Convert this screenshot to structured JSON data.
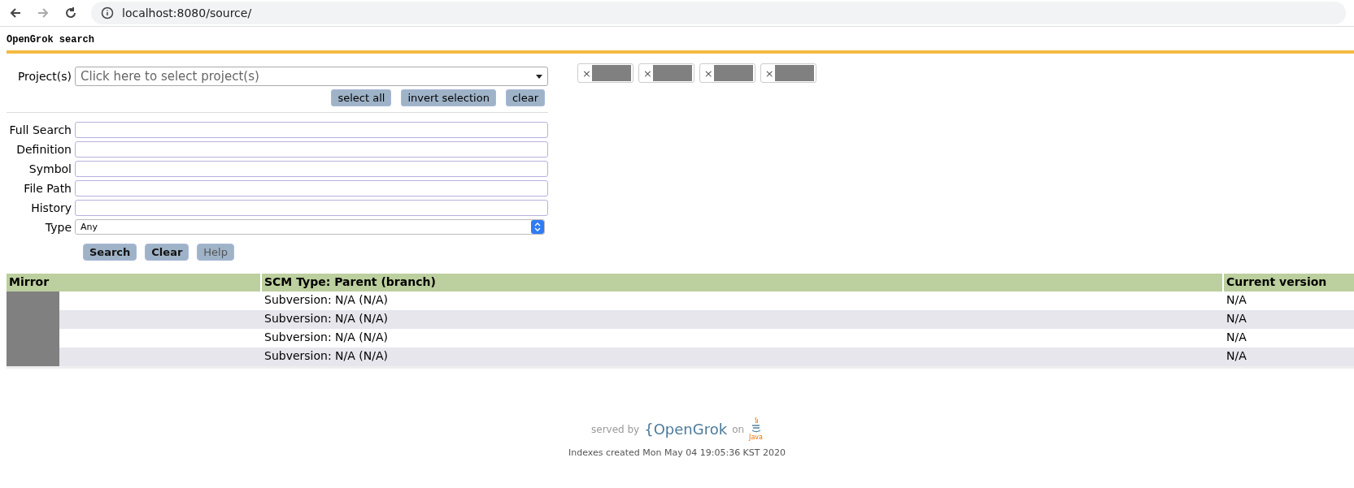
{
  "browser": {
    "url": "localhost:8080/source/"
  },
  "header": {
    "title": "OpenGrok search"
  },
  "projects": {
    "label": "Project(s)",
    "placeholder": "Click here to select project(s)",
    "buttons": [
      "select all",
      "invert selection",
      "clear"
    ],
    "chips": [
      {
        "remove": "×"
      },
      {
        "remove": "×"
      },
      {
        "remove": "×"
      },
      {
        "remove": "×"
      }
    ]
  },
  "fields": [
    {
      "label": "Full Search",
      "kind": "text"
    },
    {
      "label": "Definition",
      "kind": "text"
    },
    {
      "label": "Symbol",
      "kind": "text"
    },
    {
      "label": "File Path",
      "kind": "text"
    },
    {
      "label": "History",
      "kind": "text"
    },
    {
      "label": "Type",
      "kind": "select",
      "value": "Any"
    }
  ],
  "actions": [
    {
      "label": "Search",
      "disabled": false
    },
    {
      "label": "Clear",
      "disabled": false
    },
    {
      "label": "Help",
      "disabled": true
    }
  ],
  "table": {
    "columns": [
      "Mirror",
      "SCM Type: Parent (branch)",
      "Current version"
    ],
    "rows": [
      {
        "scm": "Subversion: N/A (N/A)",
        "version": "N/A"
      },
      {
        "scm": "Subversion: N/A (N/A)",
        "version": "N/A"
      },
      {
        "scm": "Subversion: N/A (N/A)",
        "version": "N/A"
      },
      {
        "scm": "Subversion: N/A (N/A)",
        "version": "N/A"
      }
    ]
  },
  "footer": {
    "served_by": "served by",
    "logo": "{OpenGrok",
    "on": "on",
    "java": "Java",
    "indexes": "Indexes created Mon May 04 19:05:36 KST 2020"
  }
}
